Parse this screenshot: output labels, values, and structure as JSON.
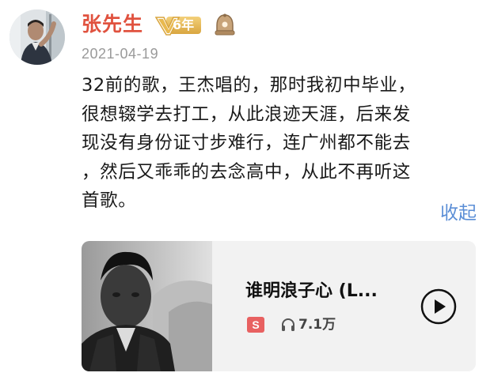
{
  "user": {
    "name": "张先生",
    "vip_years": "6年",
    "avatar_icon": "user-avatar",
    "medal_icon": "bell-medal-icon"
  },
  "comment": {
    "date": "2021-04-19",
    "lines": [
      "32前的歌，王杰唱的，那时我初中毕业，",
      "很想辍学去打工，从此浪迹天涯，后来发",
      "现没有身份证寸步难行，连广州都不能去",
      "，然后又乖乖的去念高中，从此不再听这",
      "首歌。"
    ],
    "collapse_label": "收起"
  },
  "song": {
    "title": "谁明浪子心 (L...",
    "source_badge": "S",
    "play_count": "7.1万",
    "icons": {
      "headphones": "headphones-icon",
      "play": "play-icon"
    }
  },
  "colors": {
    "username": "#e0523f",
    "link": "#5b8ed6",
    "card_bg": "#f2f2f2",
    "badge": "#e86161"
  }
}
